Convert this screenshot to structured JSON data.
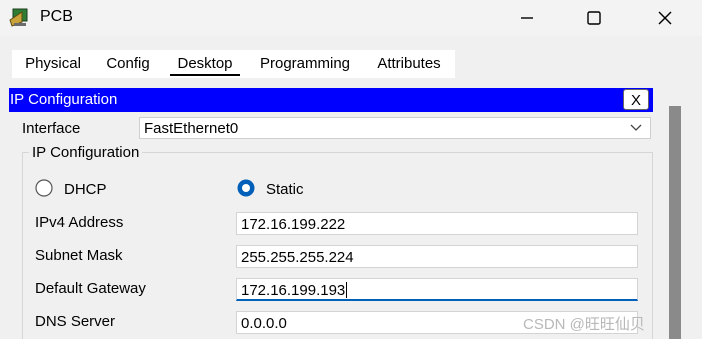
{
  "window": {
    "title": "PCB",
    "minimize_icon": "minimize-icon",
    "maximize_icon": "maximize-icon",
    "close_icon": "close-icon"
  },
  "tabs": [
    {
      "label": "Physical",
      "active": false
    },
    {
      "label": "Config",
      "active": false
    },
    {
      "label": "Desktop",
      "active": true
    },
    {
      "label": "Programming",
      "active": false
    },
    {
      "label": "Attributes",
      "active": false
    }
  ],
  "ip_panel": {
    "header_title": "IP Configuration",
    "close_label": "X",
    "interface_label": "Interface",
    "interface_value": "FastEthernet0",
    "group_title": "IP Configuration",
    "dhcp_label": "DHCP",
    "static_label": "Static",
    "selected_mode": "Static",
    "fields": {
      "ipv4_label": "IPv4 Address",
      "ipv4_value": "172.16.199.222",
      "subnet_label": "Subnet Mask",
      "subnet_value": "255.255.255.224",
      "gateway_label": "Default Gateway",
      "gateway_value": "172.16.199.193",
      "dns_label": "DNS Server",
      "dns_value": "0.0.0.0"
    }
  },
  "watermark": "CSDN @旺旺仙贝",
  "colors": {
    "header_bg": "#0000ff",
    "radio_selected": "#005fb8",
    "focus_underline": "#005fb8"
  }
}
